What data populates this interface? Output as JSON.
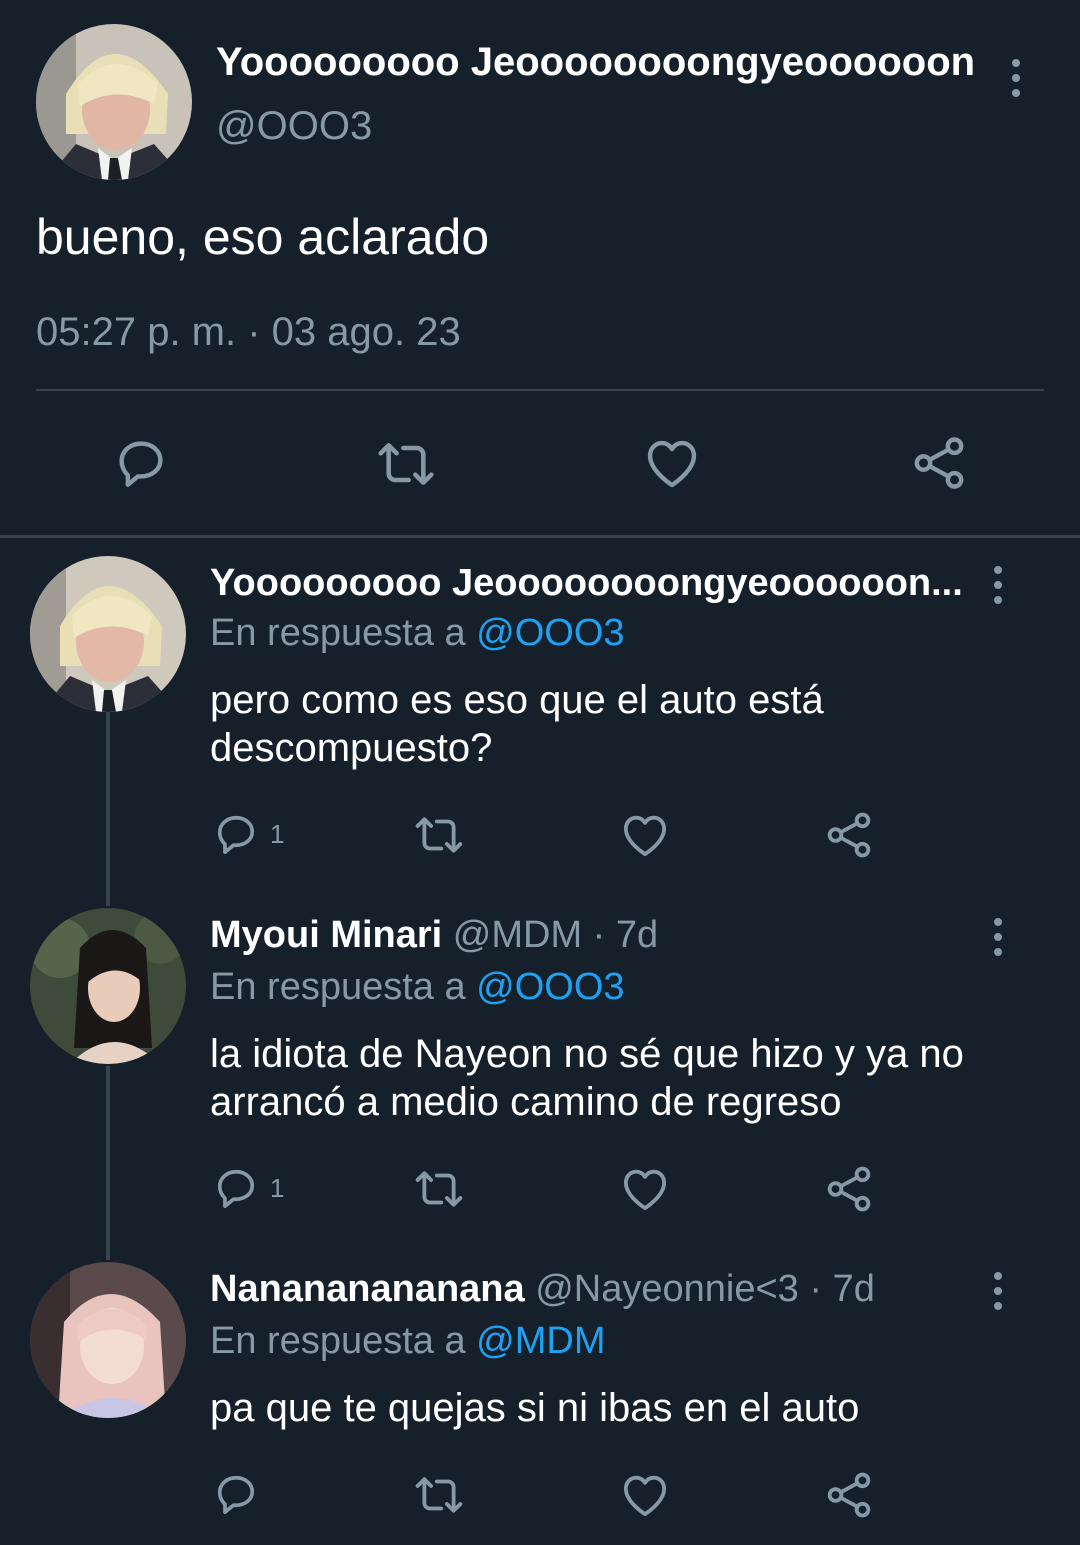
{
  "main_tweet": {
    "display_name": "Yooooooooo Jeoooooooongyeoooooon",
    "handle": "@OOO3",
    "text": "bueno, eso aclarado",
    "timestamp": "05:27 p. m. · 03 ago. 23"
  },
  "replies": [
    {
      "display_name": "Yooooooooo Jeoooooooongyeoooooon...",
      "meta": "",
      "reply_prefix": "En respuesta a",
      "reply_to": "@OOO3",
      "text_line1": "pero como es eso que el auto está",
      "text_line2": "descompuesto?",
      "reply_count": "1"
    },
    {
      "display_name": "Myoui Minari",
      "meta": "@MDM · 7d",
      "reply_prefix": "En respuesta a",
      "reply_to": "@OOO3",
      "text_line1": "la idiota de Nayeon no sé que hizo y ya no",
      "text_line2": "arrancó a medio camino de regreso",
      "reply_count": "1"
    },
    {
      "display_name": "Nanananananana",
      "meta": "@Nayeonnie<3 · 7d",
      "reply_prefix": "En respuesta a",
      "reply_to": "@MDM",
      "text_line1": "pa que te quejas si ni ibas en el auto",
      "text_line2": "",
      "reply_count": ""
    }
  ],
  "icons": [
    "reply-icon",
    "retweet-icon",
    "like-icon",
    "share-icon",
    "more-options-icon"
  ],
  "colors": {
    "background": "#15202b",
    "muted": "#8899a6",
    "link": "#1da1f2",
    "divider": "#38444d"
  }
}
